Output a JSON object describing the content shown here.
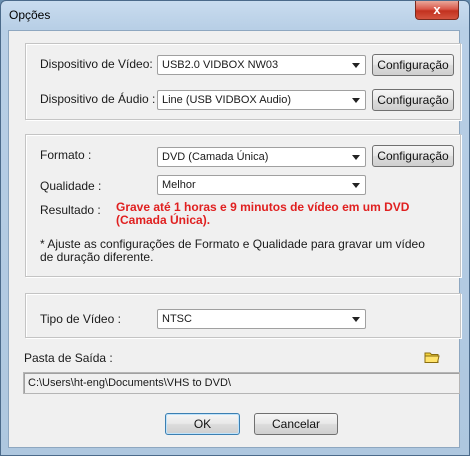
{
  "window": {
    "title": "Opções",
    "close_label": "x"
  },
  "devices": {
    "video_label": "Dispositivo de Vídeo:",
    "video_value": "USB2.0 VIDBOX NW03",
    "audio_label": "Dispositivo de Áudio :",
    "audio_value": "Line (USB VIDBOX Audio)",
    "config_label": "Configuração"
  },
  "format": {
    "format_label": "Formato :",
    "format_value": "DVD (Camada Única)",
    "quality_label": "Qualidade :",
    "quality_value": "Melhor",
    "result_label": "Resultado :",
    "result_text": "Grave até 1 horas e 9 minutos de vídeo em um DVD (Camada Única).",
    "note": "* Ajuste as configurações de Formato e Qualidade para gravar um vídeo de duração diferente."
  },
  "video_type": {
    "label": "Tipo de Vídeo :",
    "value": "NTSC"
  },
  "output": {
    "label": "Pasta de Saída :",
    "path": "C:\\Users\\ht-eng\\Documents\\VHS to DVD\\"
  },
  "footer": {
    "ok_label": "OK",
    "cancel_label": "Cancelar"
  },
  "colors": {
    "result": "#e02020",
    "accent": "#3c7fb1",
    "folder": "#f2d23b"
  }
}
